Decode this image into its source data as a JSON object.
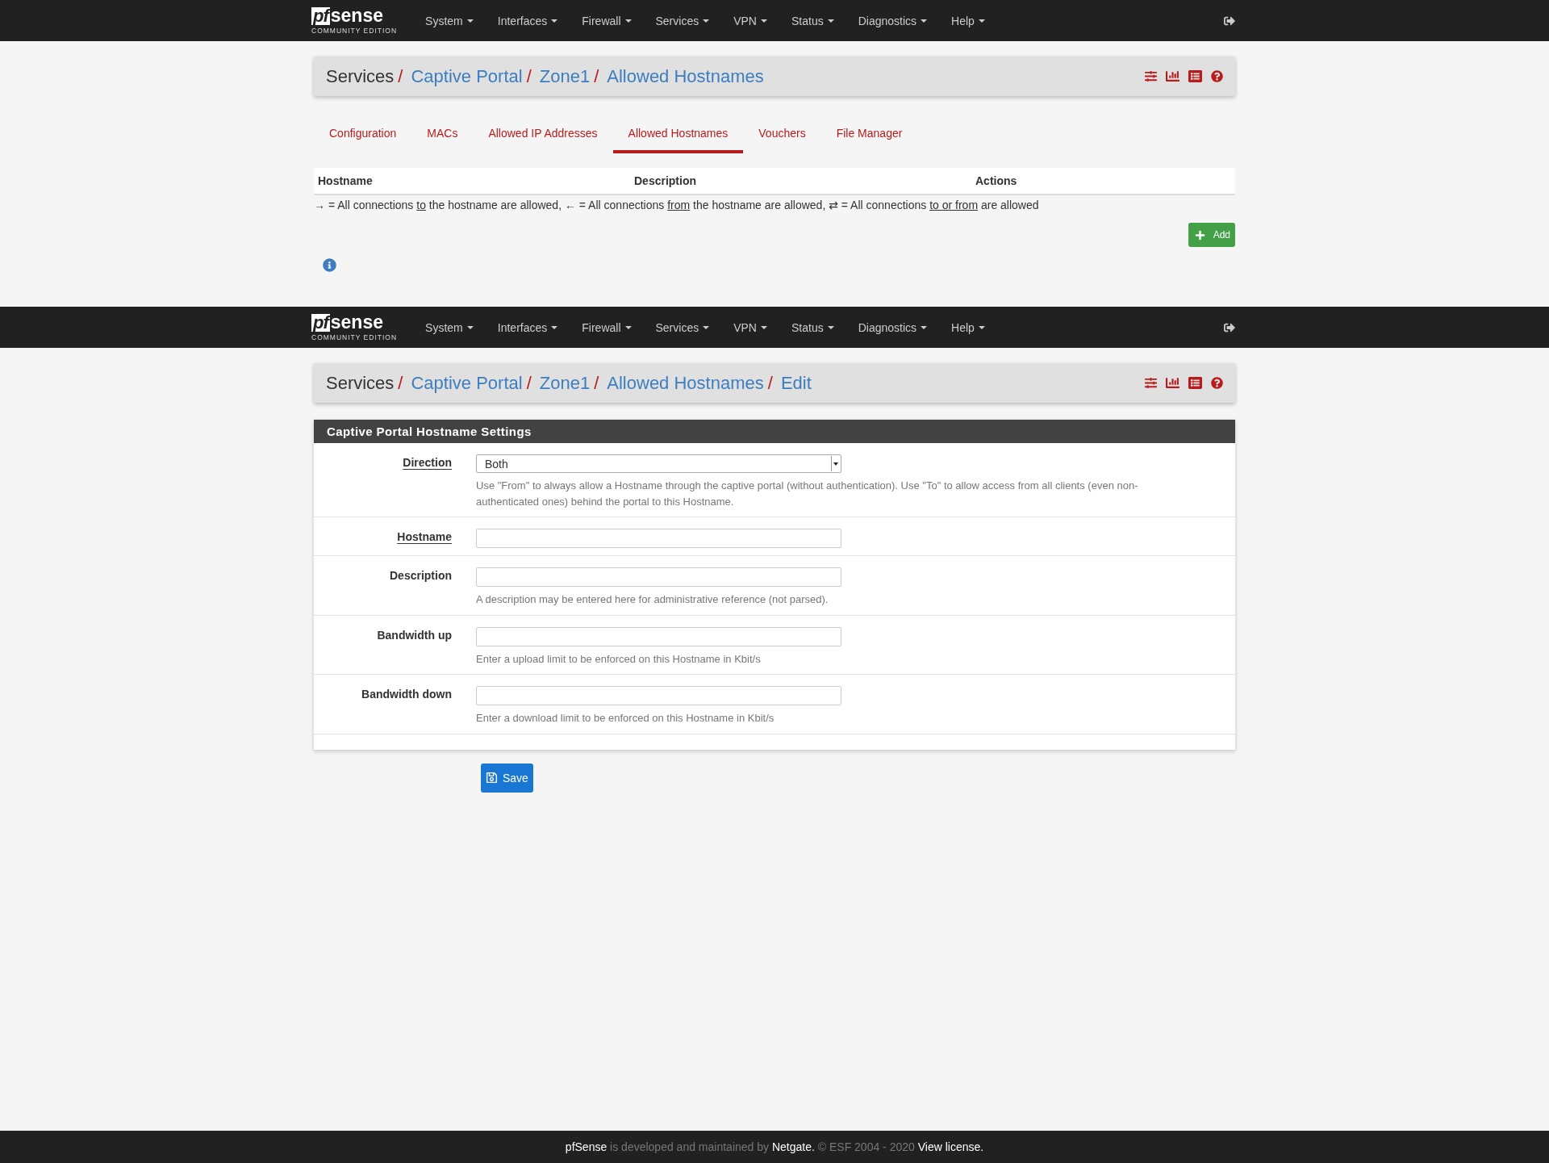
{
  "top_navbar": {
    "logo": {
      "mark": "pf",
      "word": "sense",
      "edition": "COMMUNITY EDITION"
    },
    "menus": [
      "System",
      "Interfaces",
      "Firewall",
      "Services",
      "VPN",
      "Status",
      "Diagnostics",
      "Help"
    ]
  },
  "list_view": {
    "breadcrumb": [
      {
        "text": "Services",
        "link": false,
        "separator": "/"
      },
      {
        "text": "Captive Portal",
        "link": true,
        "separator": "/"
      },
      {
        "text": "Zone1",
        "link": true,
        "separator": "/"
      },
      {
        "text": "Allowed Hostnames",
        "link": true
      }
    ],
    "tabs": [
      {
        "label": "Configuration",
        "selected": false
      },
      {
        "label": "MACs",
        "selected": false
      },
      {
        "label": "Allowed IP Addresses",
        "selected": false
      },
      {
        "label": "Allowed Hostnames",
        "selected": true
      },
      {
        "label": "Vouchers",
        "selected": false
      },
      {
        "label": "File Manager",
        "selected": false
      }
    ],
    "table": {
      "columns": [
        "Hostname",
        "Description",
        "Actions"
      ]
    },
    "legend": [
      {
        "text": "→ = All connections ",
        "underline": false
      },
      {
        "text": "to",
        "underline": true
      },
      {
        "text": " the hostname are allowed, ← = All connections ",
        "underline": false
      },
      {
        "text": "from",
        "underline": true
      },
      {
        "text": " the hostname are allowed, ⇄ = All connections ",
        "underline": false
      },
      {
        "text": "to or from",
        "underline": true
      },
      {
        "text": " are allowed",
        "underline": false
      }
    ],
    "add_button": "Add"
  },
  "second_navbar": {
    "logo": {
      "mark": "pf",
      "word": "sense",
      "edition": "COMMUNITY EDITION"
    },
    "menus": [
      "System",
      "Interfaces",
      "Firewall",
      "Services",
      "VPN",
      "Status",
      "Diagnostics",
      "Help"
    ]
  },
  "edit_view": {
    "breadcrumb": [
      {
        "text": "Services",
        "link": false,
        "separator": "/"
      },
      {
        "text": "Captive Portal",
        "link": true,
        "separator": "/"
      },
      {
        "text": "Zone1",
        "link": true,
        "separator": "/"
      },
      {
        "text": "Allowed Hostnames",
        "link": true,
        "separator": "/"
      },
      {
        "text": "Edit",
        "link": true
      }
    ],
    "panel_title": "Captive Portal Hostname Settings",
    "fields": [
      {
        "label": "Direction",
        "required": true,
        "kind": "select",
        "value": "Both",
        "help": "Use \"From\" to always allow a Hostname through the captive portal (without authentication). Use \"To\" to allow access from all clients (even non-authenticated ones) behind the portal to this Hostname."
      },
      {
        "label": "Hostname",
        "required": true,
        "kind": "text"
      },
      {
        "label": "Description",
        "required": false,
        "kind": "text",
        "help": "A description may be entered here for administrative reference (not parsed)."
      },
      {
        "label": "Bandwidth up",
        "required": false,
        "kind": "text",
        "help": "Enter a upload limit to be enforced on this Hostname in Kbit/s"
      },
      {
        "label": "Bandwidth down",
        "required": false,
        "kind": "text",
        "help": "Enter a download limit to be enforced on this Hostname in Kbit/s"
      }
    ],
    "save_button": "Save"
  },
  "footer": [
    {
      "text": "pfSense",
      "bright": true
    },
    {
      "text": " is developed and maintained by ",
      "bright": false
    },
    {
      "text": "Netgate.",
      "bright": true
    },
    {
      "text": " © ESF 2004 - 2020",
      "bright": false
    },
    {
      "text": " View license.",
      "bright": true
    }
  ]
}
